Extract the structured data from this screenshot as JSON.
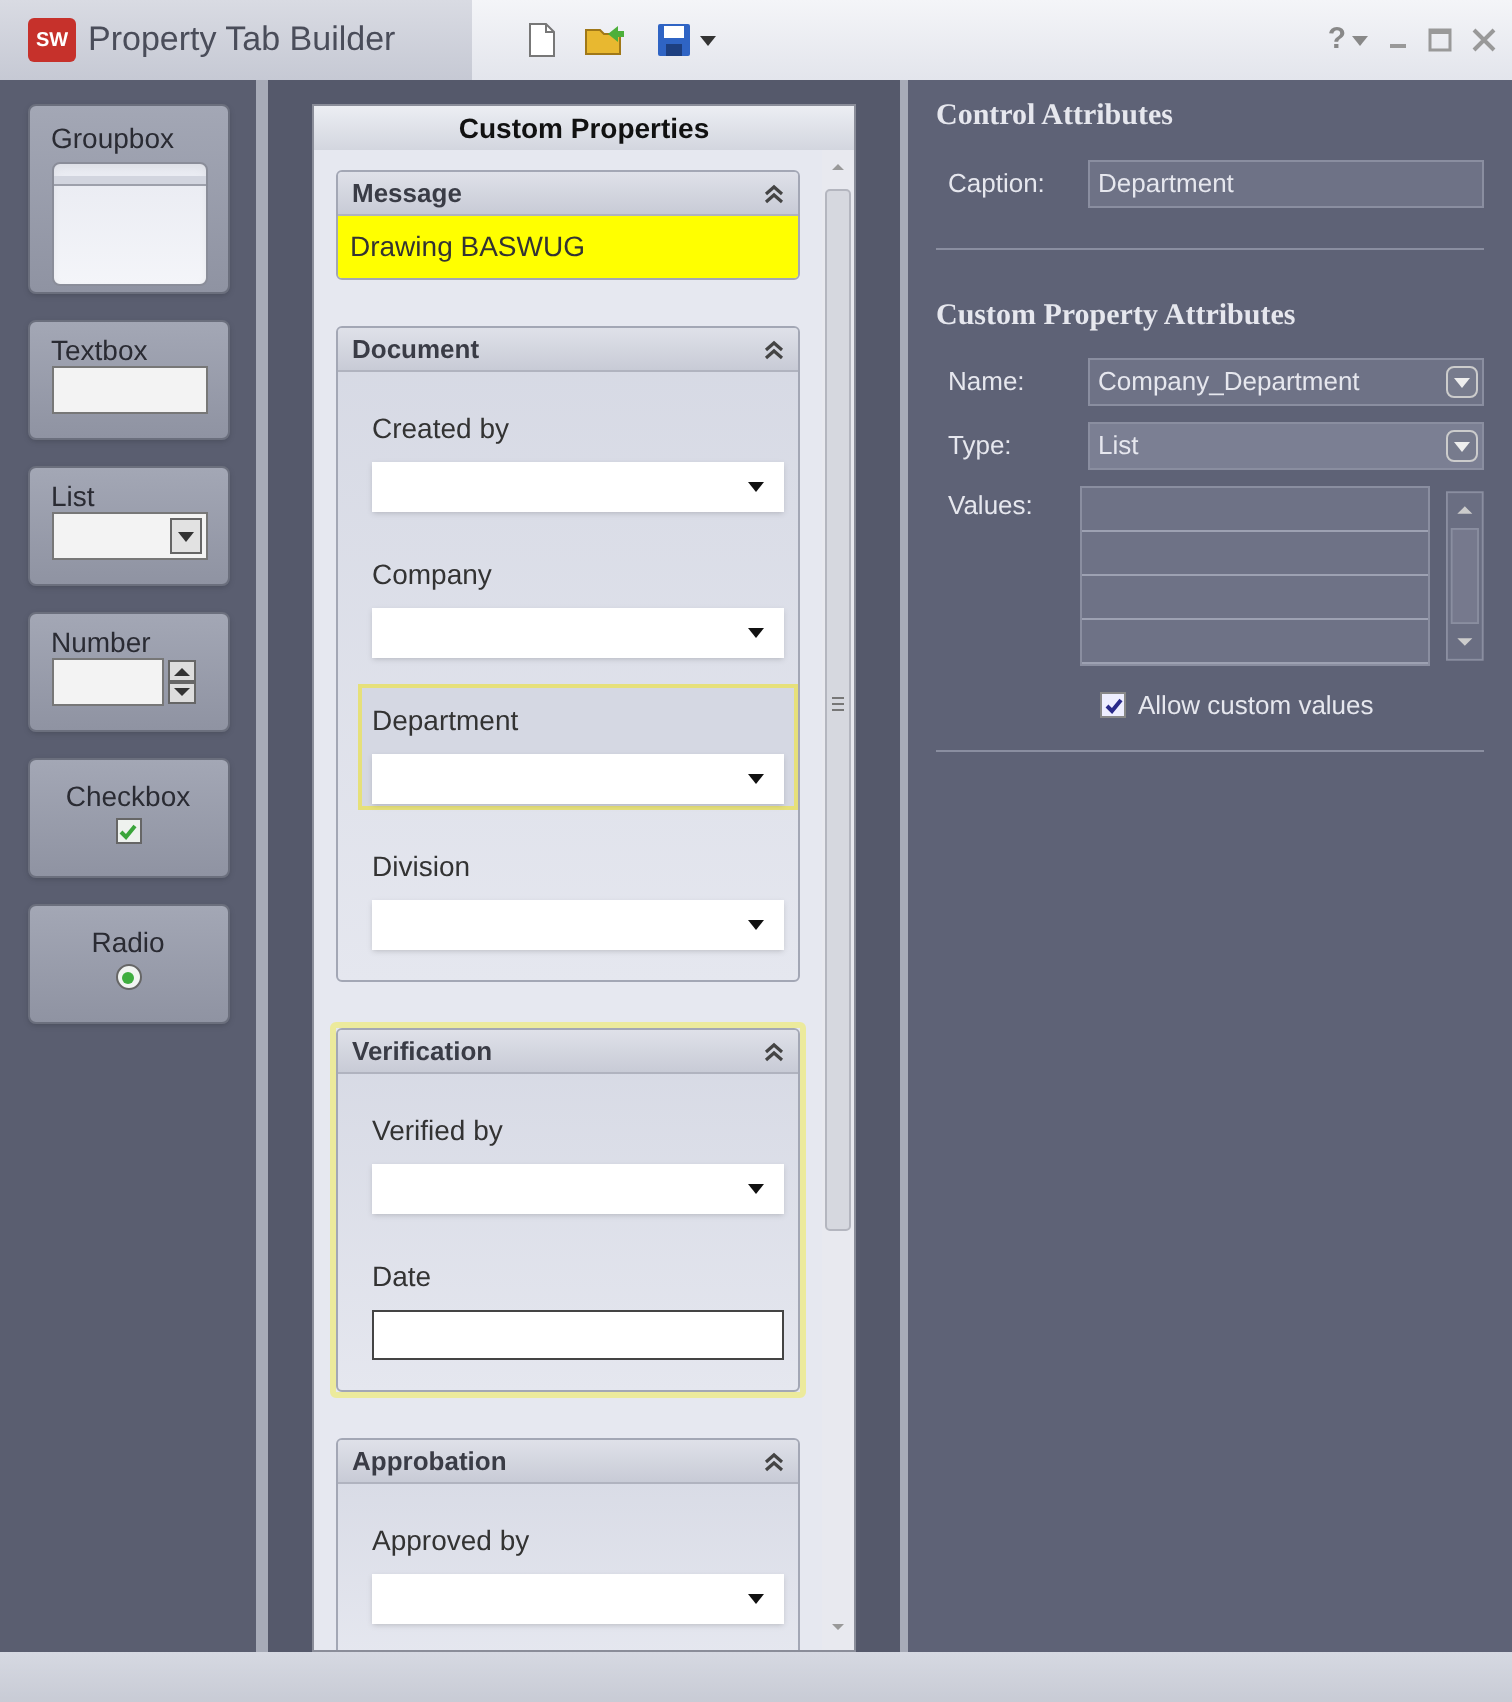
{
  "window": {
    "logo": "SW",
    "title": "Property Tab Builder",
    "help": "?"
  },
  "palette": [
    {
      "label": "Groupbox",
      "kind": "groupbox"
    },
    {
      "label": "Textbox",
      "kind": "textbox"
    },
    {
      "label": "List",
      "kind": "list"
    },
    {
      "label": "Number",
      "kind": "number"
    },
    {
      "label": "Checkbox",
      "kind": "checkbox",
      "checked": true
    },
    {
      "label": "Radio",
      "kind": "radio",
      "selected": true
    }
  ],
  "form": {
    "title": "Custom Properties",
    "groups": [
      {
        "title": "Message",
        "selected": false,
        "message": "Drawing BASWUG"
      },
      {
        "title": "Document",
        "selected": false,
        "fields": [
          {
            "label": "Created by",
            "kind": "list",
            "selected": false
          },
          {
            "label": "Company",
            "kind": "list",
            "selected": false
          },
          {
            "label": "Department",
            "kind": "list",
            "selected": true
          },
          {
            "label": "Division",
            "kind": "list",
            "selected": false
          }
        ]
      },
      {
        "title": "Verification",
        "selected": true,
        "fields": [
          {
            "label": "Verified by",
            "kind": "list",
            "selected": false
          },
          {
            "label": "Date",
            "kind": "text",
            "selected": false
          }
        ]
      },
      {
        "title": "Approbation",
        "selected": false,
        "fields": [
          {
            "label": "Approved by",
            "kind": "list",
            "selected": false
          }
        ]
      }
    ]
  },
  "attributes": {
    "control_title": "Control Attributes",
    "caption_label": "Caption:",
    "caption_value": "Department",
    "custom_title": "Custom Property Attributes",
    "name_label": "Name:",
    "name_value": "Company_Department",
    "type_label": "Type:",
    "type_value": "List",
    "values_label": "Values:",
    "allow_custom": {
      "label": "Allow custom values",
      "checked": true
    }
  }
}
